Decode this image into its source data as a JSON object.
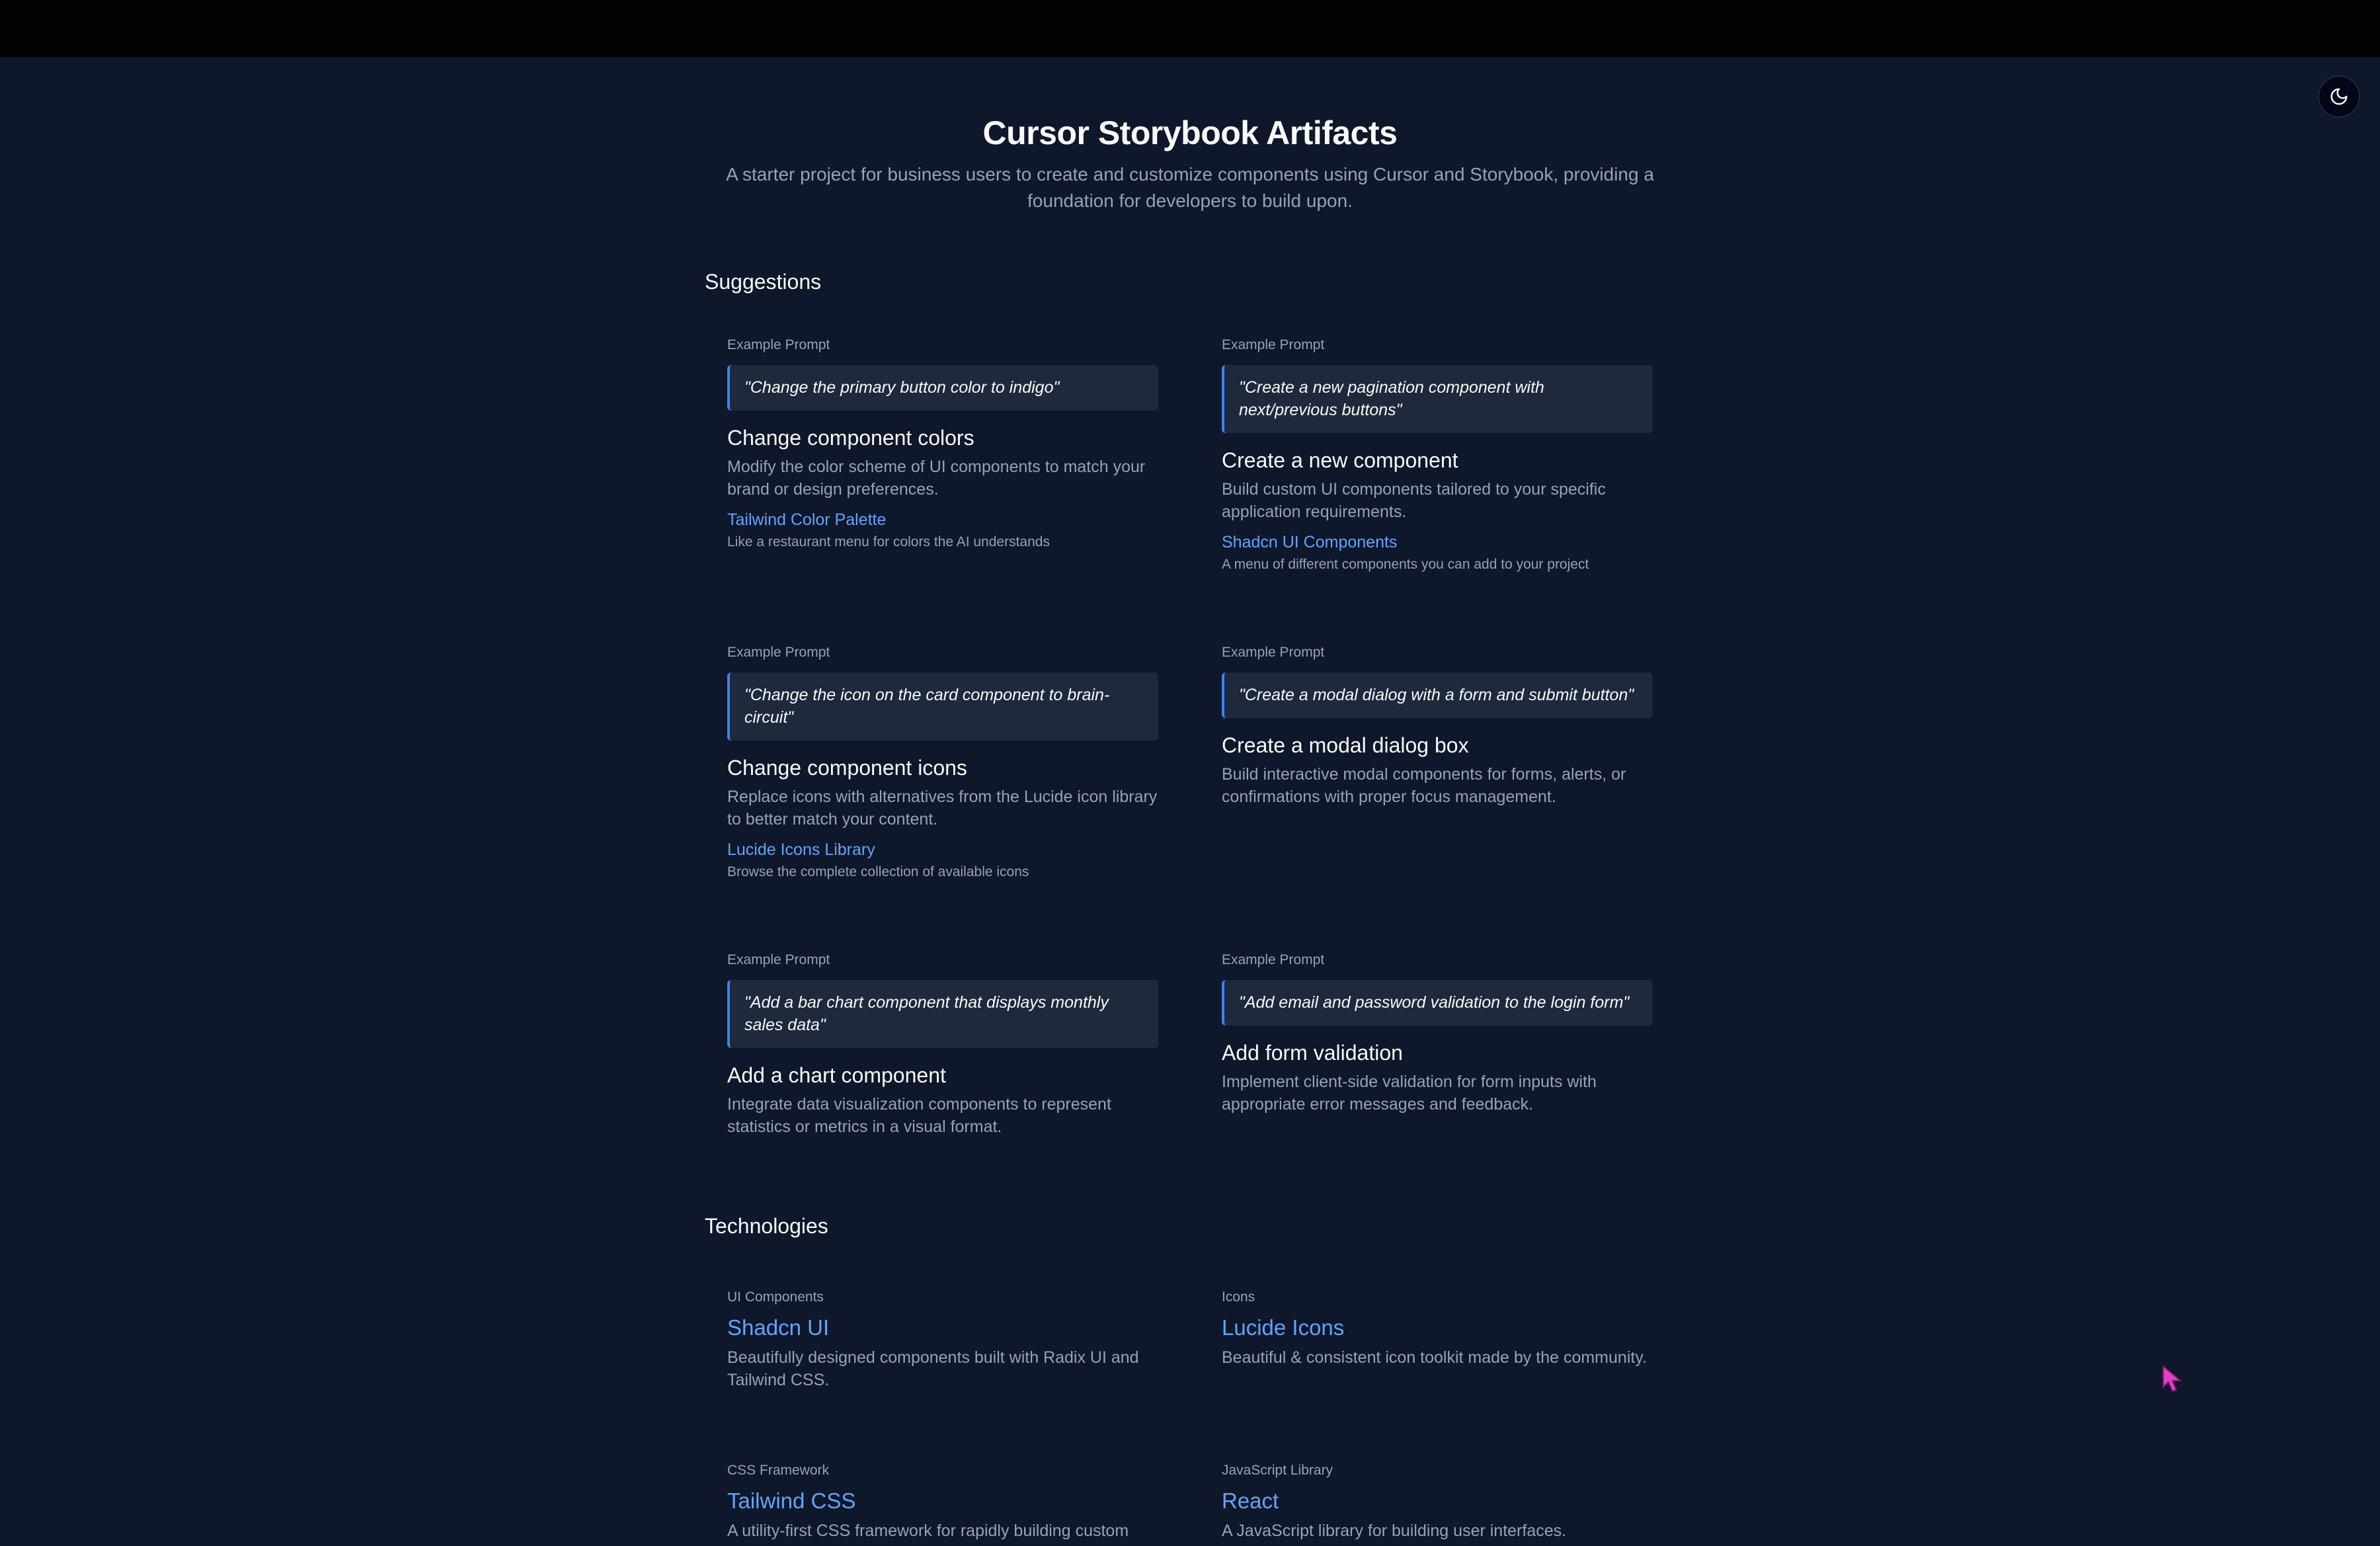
{
  "header": {
    "title": "Cursor Storybook Artifacts",
    "subtitle": "A starter project for business users to create and customize components using Cursor and Storybook, providing a foundation for developers to build upon."
  },
  "theme_toggle": {
    "icon": "moon-icon"
  },
  "suggestions": {
    "heading": "Suggestions",
    "items": [
      {
        "eyebrow": "Example Prompt",
        "prompt": "\"Change the primary button color to indigo\"",
        "title": "Change component colors",
        "description": "Modify the color scheme of UI components to match your brand or design preferences.",
        "link": "Tailwind Color Palette",
        "link_note": "Like a restaurant menu for colors the AI understands"
      },
      {
        "eyebrow": "Example Prompt",
        "prompt": "\"Create a new pagination component with next/previous buttons\"",
        "title": "Create a new component",
        "description": "Build custom UI components tailored to your specific application requirements.",
        "link": "Shadcn UI Components",
        "link_note": "A menu of different components you can add to your project"
      },
      {
        "eyebrow": "Example Prompt",
        "prompt": "\"Change the icon on the card component to brain-circuit\"",
        "title": "Change component icons",
        "description": "Replace icons with alternatives from the Lucide icon library to better match your content.",
        "link": "Lucide Icons Library",
        "link_note": "Browse the complete collection of available icons"
      },
      {
        "eyebrow": "Example Prompt",
        "prompt": "\"Create a modal dialog with a form and submit button\"",
        "title": "Create a modal dialog box",
        "description": "Build interactive modal components for forms, alerts, or confirmations with proper focus management."
      },
      {
        "eyebrow": "Example Prompt",
        "prompt": "\"Add a bar chart component that displays monthly sales data\"",
        "title": "Add a chart component",
        "description": "Integrate data visualization components to represent statistics or metrics in a visual format."
      },
      {
        "eyebrow": "Example Prompt",
        "prompt": "\"Add email and password validation to the login form\"",
        "title": "Add form validation",
        "description": "Implement client-side validation for form inputs with appropriate error messages and feedback."
      }
    ]
  },
  "technologies": {
    "heading": "Technologies",
    "items": [
      {
        "category": "UI Components",
        "name": "Shadcn UI",
        "description": "Beautifully designed components built with Radix UI and Tailwind CSS."
      },
      {
        "category": "Icons",
        "name": "Lucide Icons",
        "description": "Beautiful & consistent icon toolkit made by the community."
      },
      {
        "category": "CSS Framework",
        "name": "Tailwind CSS",
        "description": "A utility-first CSS framework for rapidly building custom"
      },
      {
        "category": "JavaScript Library",
        "name": "React",
        "description": "A JavaScript library for building user interfaces."
      }
    ]
  },
  "colors": {
    "background": "#0f172a",
    "card_surface": "#1e293b",
    "accent": "#3b82f6",
    "link": "#60a5fa",
    "muted_text": "#94a3b8",
    "cursor": "#e040c8"
  }
}
